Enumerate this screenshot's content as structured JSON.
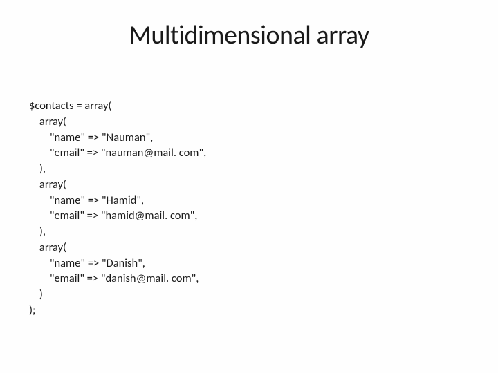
{
  "title": "Multidimensional array",
  "code": "$contacts = array(\n    array(\n        \"name\" => \"Nauman\",\n        \"email\" => \"nauman@mail. com\",\n    ),\n    array(\n        \"name\" => \"Hamid\",\n        \"email\" => \"hamid@mail. com\",\n    ),\n    array(\n        \"name\" => \"Danish\",\n        \"email\" => \"danish@mail. com\",\n    )\n);"
}
